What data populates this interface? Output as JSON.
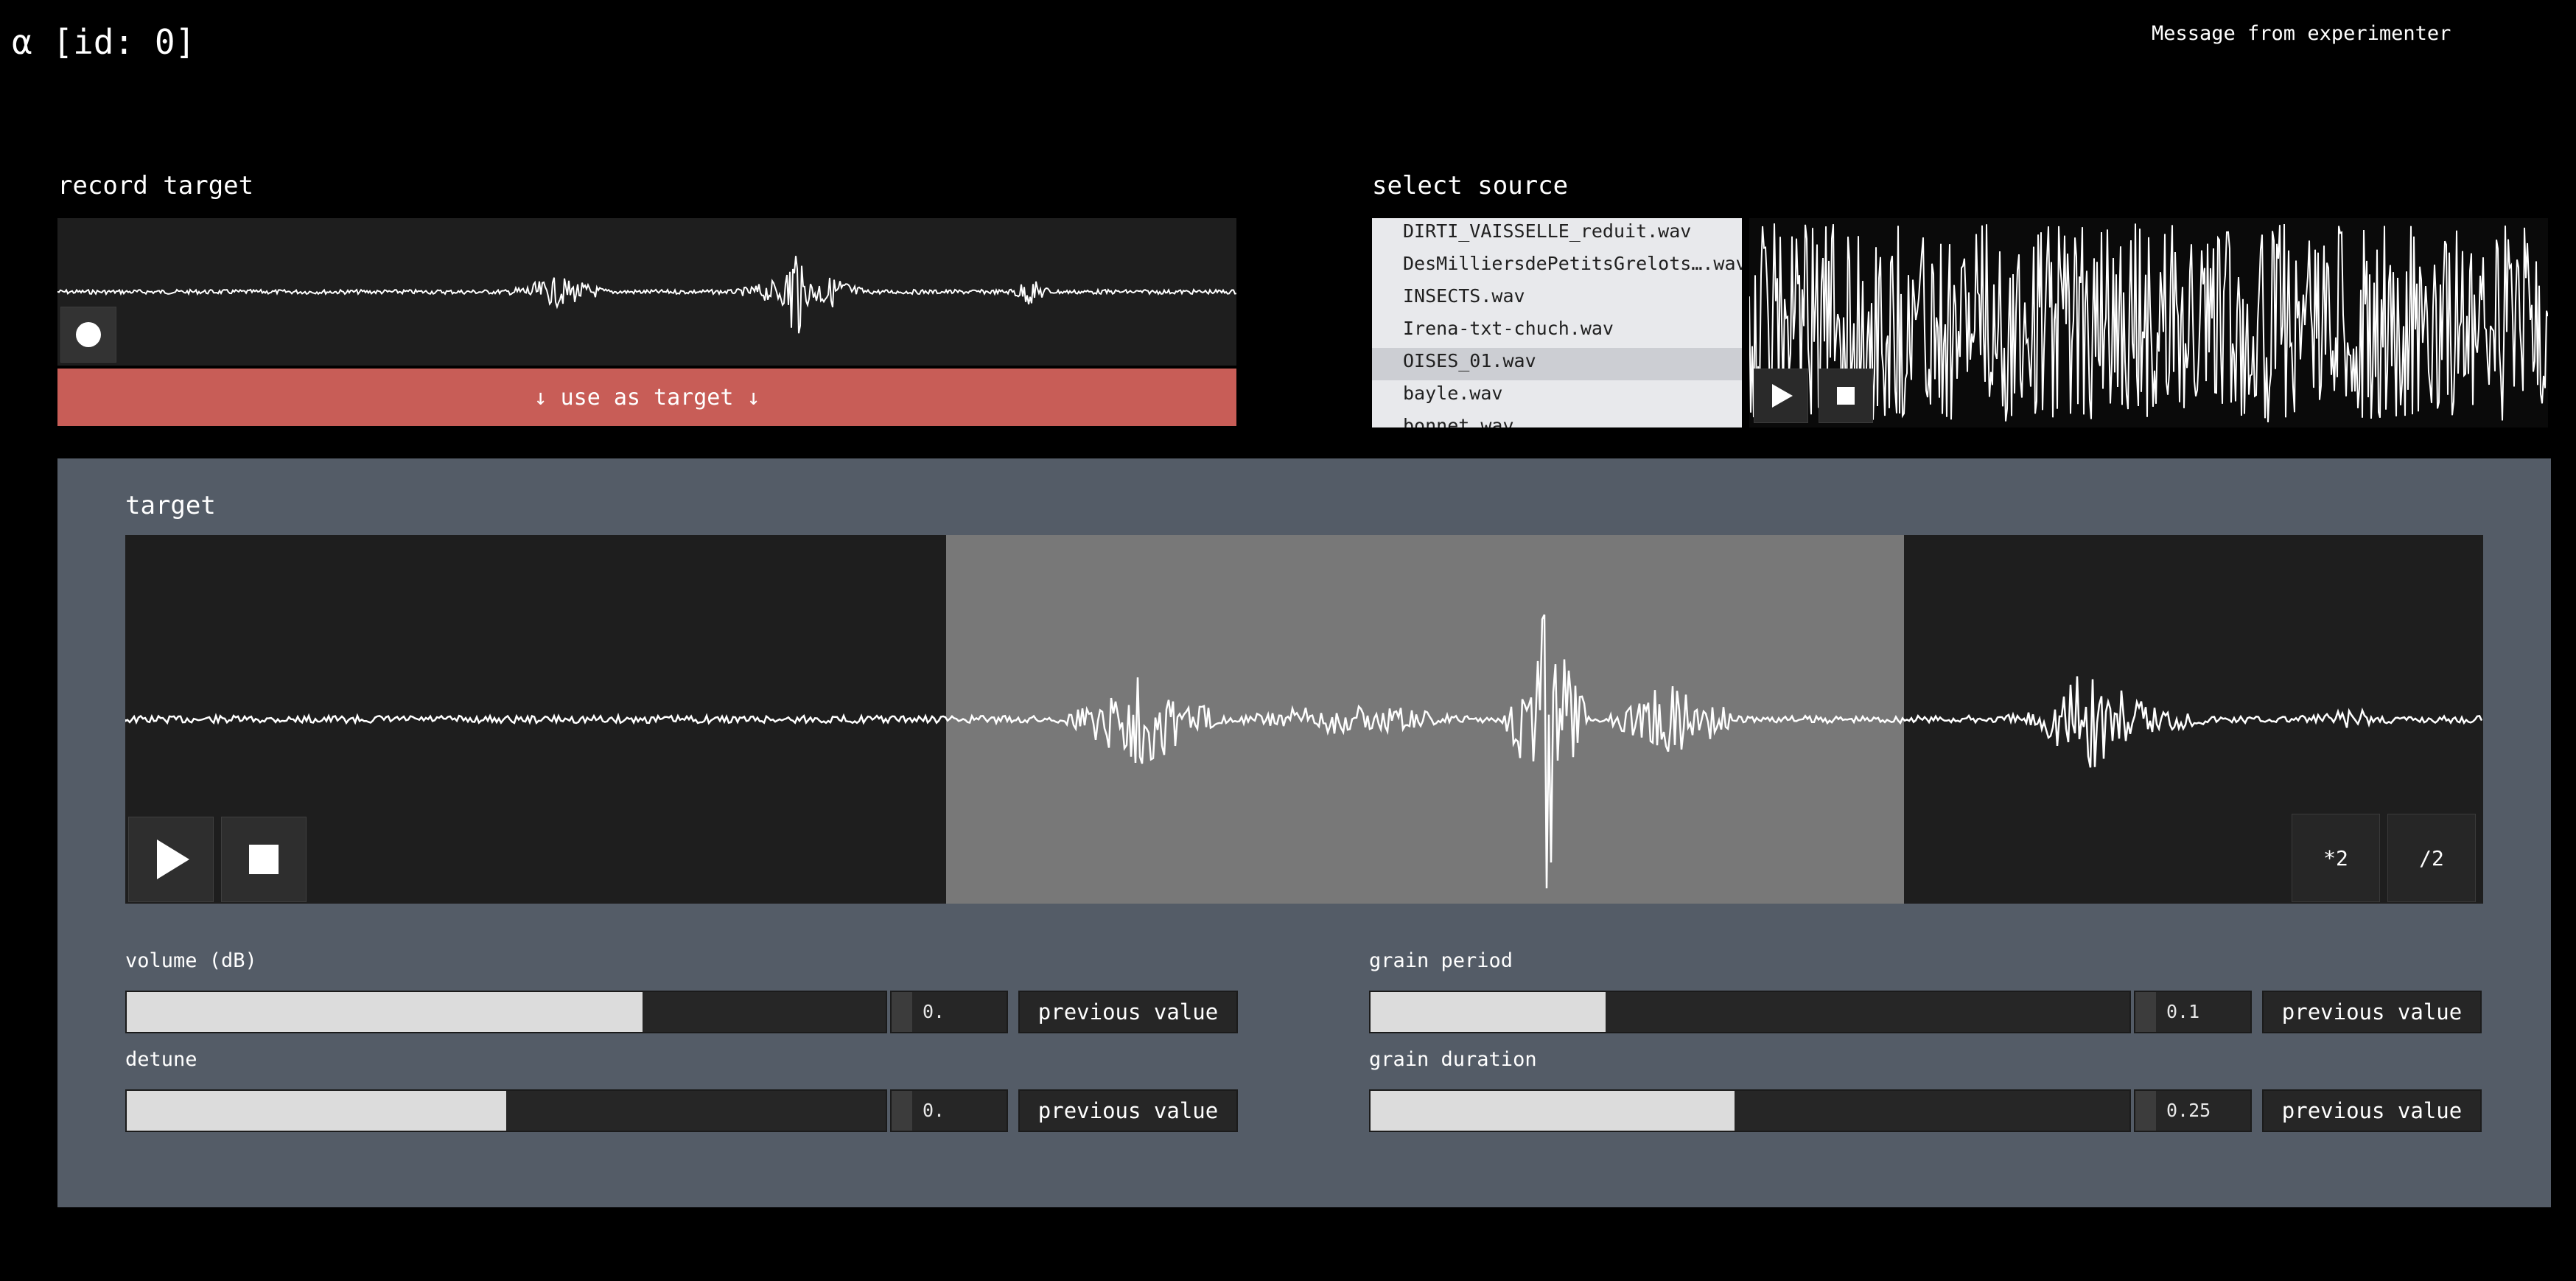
{
  "app": {
    "title": "α [id: 0]",
    "message": "Message from experimenter"
  },
  "record_target": {
    "label": "record target",
    "use_button": "↓ use as target ↓"
  },
  "select_source": {
    "label": "select source",
    "files": [
      "DIRTI_VAISSELLE_reduit.wav",
      "DesMilliersdePetitsGrelots….wav",
      "INSECTS.wav",
      "Irena-txt-chuch.wav",
      "OISES_01.wav",
      "bayle.wav",
      "bonnet.wav"
    ],
    "selected_file": "OISES_01.wav"
  },
  "target": {
    "label": "target",
    "zoom_in": "*2",
    "zoom_out": "/2"
  },
  "params": {
    "volume": {
      "label": "volume (dB)",
      "value": "0.",
      "level": 0.68,
      "prev": "previous value"
    },
    "detune": {
      "label": "detune",
      "value": "0.",
      "level": 0.5,
      "prev": "previous value"
    },
    "period": {
      "label": "grain period",
      "value": "0.1",
      "level": 0.31,
      "prev": "previous value"
    },
    "duration": {
      "label": "grain duration",
      "value": "0.25",
      "level": 0.48,
      "prev": "previous value"
    }
  },
  "icons": [
    "record-icon",
    "play-icon",
    "stop-icon"
  ],
  "colors": {
    "accent": "#c85d57",
    "panel": "#545c67",
    "selection": "#787878"
  }
}
